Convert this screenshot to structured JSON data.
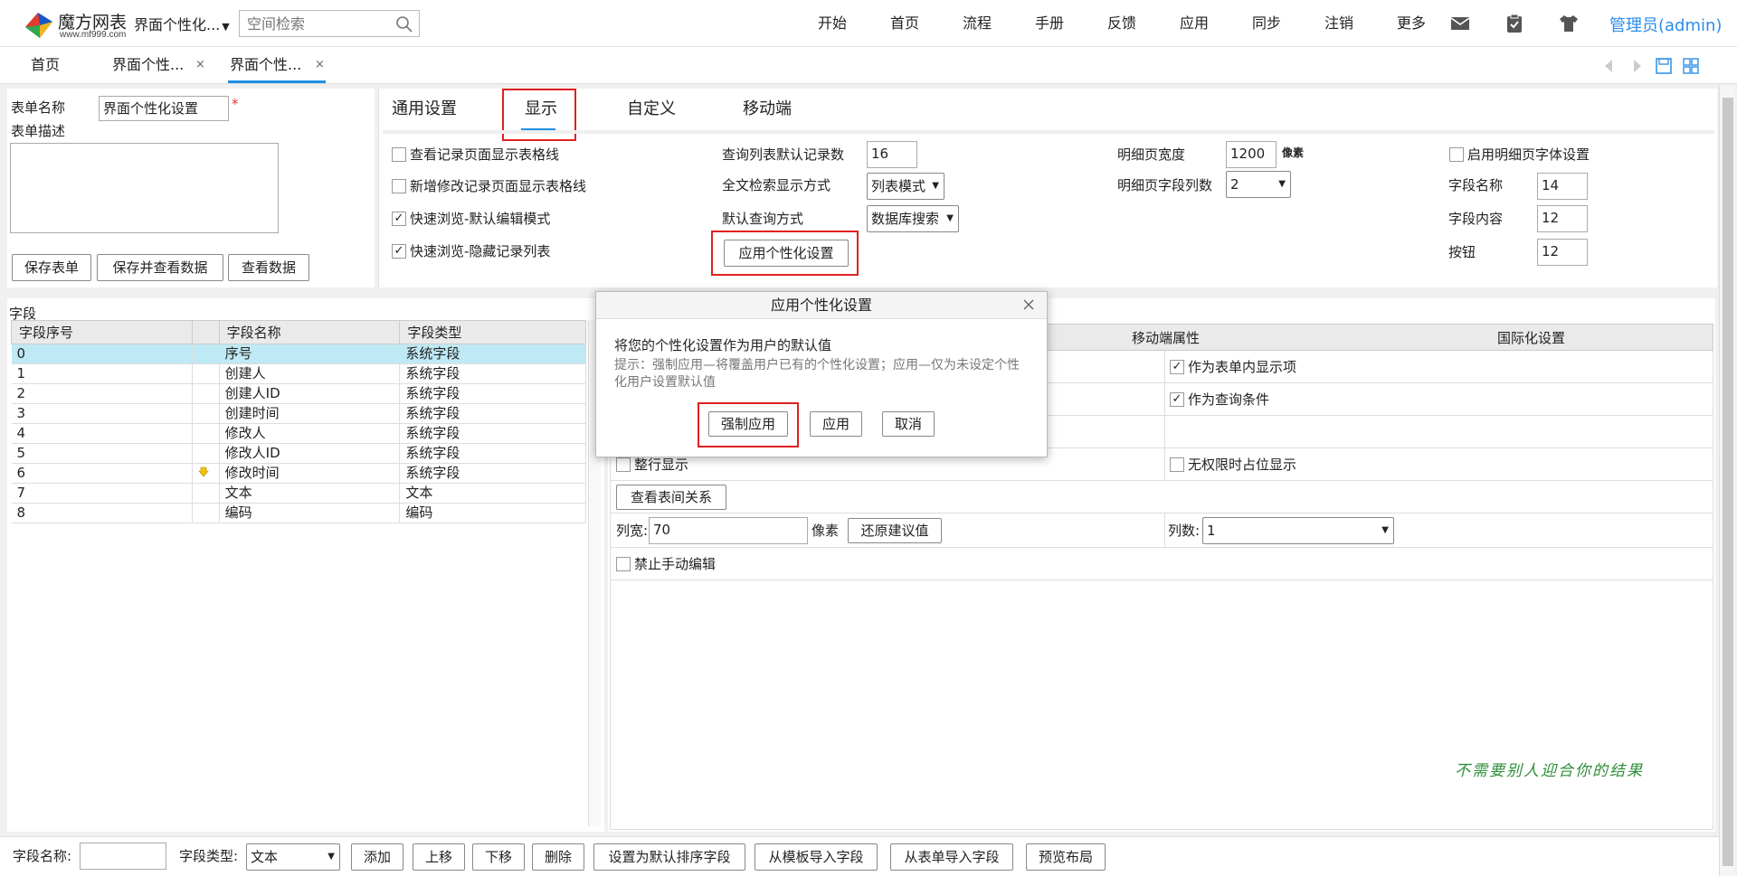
{
  "brand": {
    "name": "魔方网表",
    "url": "www.mf999.com"
  },
  "space": {
    "label": "界面个性化..."
  },
  "search": {
    "placeholder": "空间检索"
  },
  "nav": [
    "开始",
    "首页",
    "流程",
    "手册",
    "反馈",
    "应用",
    "同步",
    "注销",
    "更多"
  ],
  "user": {
    "name": "管理员(admin)"
  },
  "tabs": [
    {
      "label": "首页",
      "closable": false
    },
    {
      "label": "界面个性...",
      "closable": true
    },
    {
      "label": "界面个性...",
      "closable": true,
      "active": true
    }
  ],
  "form": {
    "name_label": "表单名称",
    "name_value": "界面个性化设置",
    "desc_label": "表单描述",
    "buttons": [
      "保存表单",
      "保存并查看数据",
      "查看数据"
    ]
  },
  "settings": {
    "tabs": [
      "通用设置",
      "显示",
      "自定义",
      "移动端"
    ],
    "active_tab": "显示",
    "col1": [
      {
        "label": "查看记录页面显示表格线",
        "checked": false
      },
      {
        "label": "新增修改记录页面显示表格线",
        "checked": false
      },
      {
        "label": "快速浏览-默认编辑模式",
        "checked": true
      },
      {
        "label": "快速浏览-隐藏记录列表",
        "checked": true
      }
    ],
    "col2": {
      "default_records_label": "查询列表默认记录数",
      "default_records_value": "16",
      "fulltext_label": "全文检索显示方式",
      "fulltext_value": "列表模式",
      "query_label": "默认查询方式",
      "query_value": "数据库搜索",
      "apply_button": "应用个性化设置"
    },
    "col3": {
      "detail_width_label": "明细页宽度",
      "detail_width_value": "1200",
      "detail_width_unit": "像素",
      "detail_cols_label": "明细页字段列数",
      "detail_cols_value": "2"
    },
    "col4": {
      "font_setting_label": "启用明细页字体设置",
      "field_name_label": "字段名称",
      "field_name_value": "14",
      "field_content_label": "字段内容",
      "field_content_value": "12",
      "button_label": "按钮",
      "button_value": "12"
    }
  },
  "fields": {
    "title": "字段",
    "headers": [
      "字段序号",
      "",
      "字段名称",
      "字段类型"
    ],
    "rows": [
      {
        "seq": "0",
        "mark": "",
        "name": "序号",
        "type": "系统字段"
      },
      {
        "seq": "1",
        "mark": "",
        "name": "创建人",
        "type": "系统字段"
      },
      {
        "seq": "2",
        "mark": "",
        "name": "创建人ID",
        "type": "系统字段"
      },
      {
        "seq": "3",
        "mark": "",
        "name": "创建时间",
        "type": "系统字段"
      },
      {
        "seq": "4",
        "mark": "",
        "name": "修改人",
        "type": "系统字段"
      },
      {
        "seq": "5",
        "mark": "",
        "name": "修改人ID",
        "type": "系统字段"
      },
      {
        "seq": "6",
        "mark": "arrow",
        "name": "修改时间",
        "type": "系统字段"
      },
      {
        "seq": "7",
        "mark": "",
        "name": "文本",
        "type": "文本"
      },
      {
        "seq": "8",
        "mark": "",
        "name": "编码",
        "type": "编码"
      }
    ]
  },
  "props": {
    "mobile_header": "移动端属性",
    "intl_header": "国际化设置",
    "show_in_form": "作为表单内显示项",
    "as_query": "作为查询条件",
    "full_row": "整行显示",
    "no_perm_placeholder": "无权限时占位显示",
    "view_relation": "查看表间关系",
    "col_width_label": "列宽:",
    "col_width_value": "70",
    "col_width_unit": "像素",
    "restore_button": "还原建议值",
    "col_count_label": "列数:",
    "col_count_value": "1",
    "no_manual_edit": "禁止手动编辑"
  },
  "toolbar": {
    "field_name_label": "字段名称:",
    "field_type_label": "字段类型:",
    "field_type_value": "文本",
    "buttons": [
      "添加",
      "上移",
      "下移",
      "删除",
      "设置为默认排序字段",
      "从模板导入字段",
      "从表单导入字段",
      "预览布局"
    ]
  },
  "dialog": {
    "title": "应用个性化设置",
    "message": "将您的个性化设置作为用户的默认值",
    "hint": "提示：强制应用—将覆盖用户已有的个性化设置；应用—仅为未设定个性化用户设置默认值",
    "buttons": [
      "强制应用",
      "应用",
      "取消"
    ]
  },
  "watermark": "不需要别人迎合你的结果",
  "colors": {
    "accent": "#1f8fe5",
    "highlight": "#e02020",
    "selected_row": "#bfe9f4"
  }
}
